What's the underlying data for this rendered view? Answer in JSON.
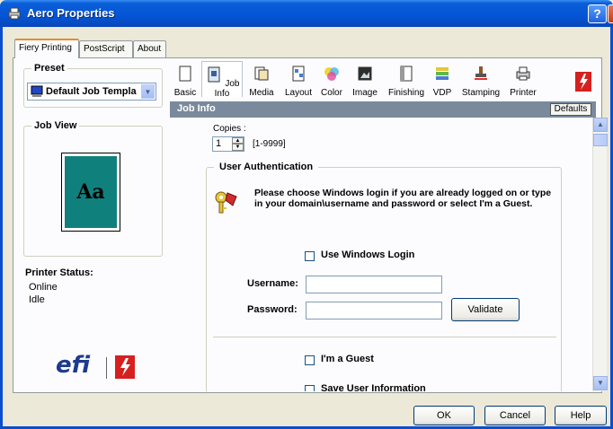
{
  "window": {
    "title": "Aero Properties",
    "help_glyph": "?",
    "close_glyph": "X"
  },
  "tabs": [
    {
      "label": "Fiery Printing",
      "active": true
    },
    {
      "label": "PostScript",
      "active": false
    },
    {
      "label": "About",
      "active": false
    }
  ],
  "sidebar": {
    "preset_title": "Preset",
    "preset_value": "Default Job Templa",
    "job_view_title": "Job View",
    "job_view_preview_text": "Aa",
    "printer_status_title": "Printer Status:",
    "printer_status_lines": [
      "Online",
      "Idle"
    ],
    "logo_text": "efi"
  },
  "toolbar": {
    "items": [
      {
        "label": "Basic",
        "icon": "page-icon"
      },
      {
        "label": "Job Info",
        "icon": "job-info-icon"
      },
      {
        "label": "Media",
        "icon": "media-icon"
      },
      {
        "label": "Layout",
        "icon": "layout-icon"
      },
      {
        "label": "Color",
        "icon": "color-wheel-icon"
      },
      {
        "label": "Image",
        "icon": "image-icon"
      },
      {
        "label": "Finishing",
        "icon": "finishing-icon"
      },
      {
        "label": "VDP",
        "icon": "vdp-icon"
      },
      {
        "label": "Stamping",
        "icon": "stamp-icon"
      },
      {
        "label": "Printer",
        "icon": "printer-icon"
      }
    ],
    "active": "Job Info"
  },
  "content": {
    "header": "Job Info",
    "defaults_label": "Defaults",
    "copies_label": "Copies :",
    "copies_value": "1",
    "copies_range": "[1-9999]",
    "user_auth_title": "User Authentication",
    "auth_message": "Please choose Windows login if you are already logged on or type in your domain\\username and password or select I'm a Guest.",
    "use_windows_login_label": "Use Windows Login",
    "username_label": "Username:",
    "username_value": "",
    "password_label": "Password:",
    "password_value": "",
    "validate_label": "Validate",
    "guest_label": "I'm a Guest",
    "save_user_info_label": "Save User Information"
  },
  "footer": {
    "ok_label": "OK",
    "cancel_label": "Cancel",
    "help_label": "Help"
  }
}
